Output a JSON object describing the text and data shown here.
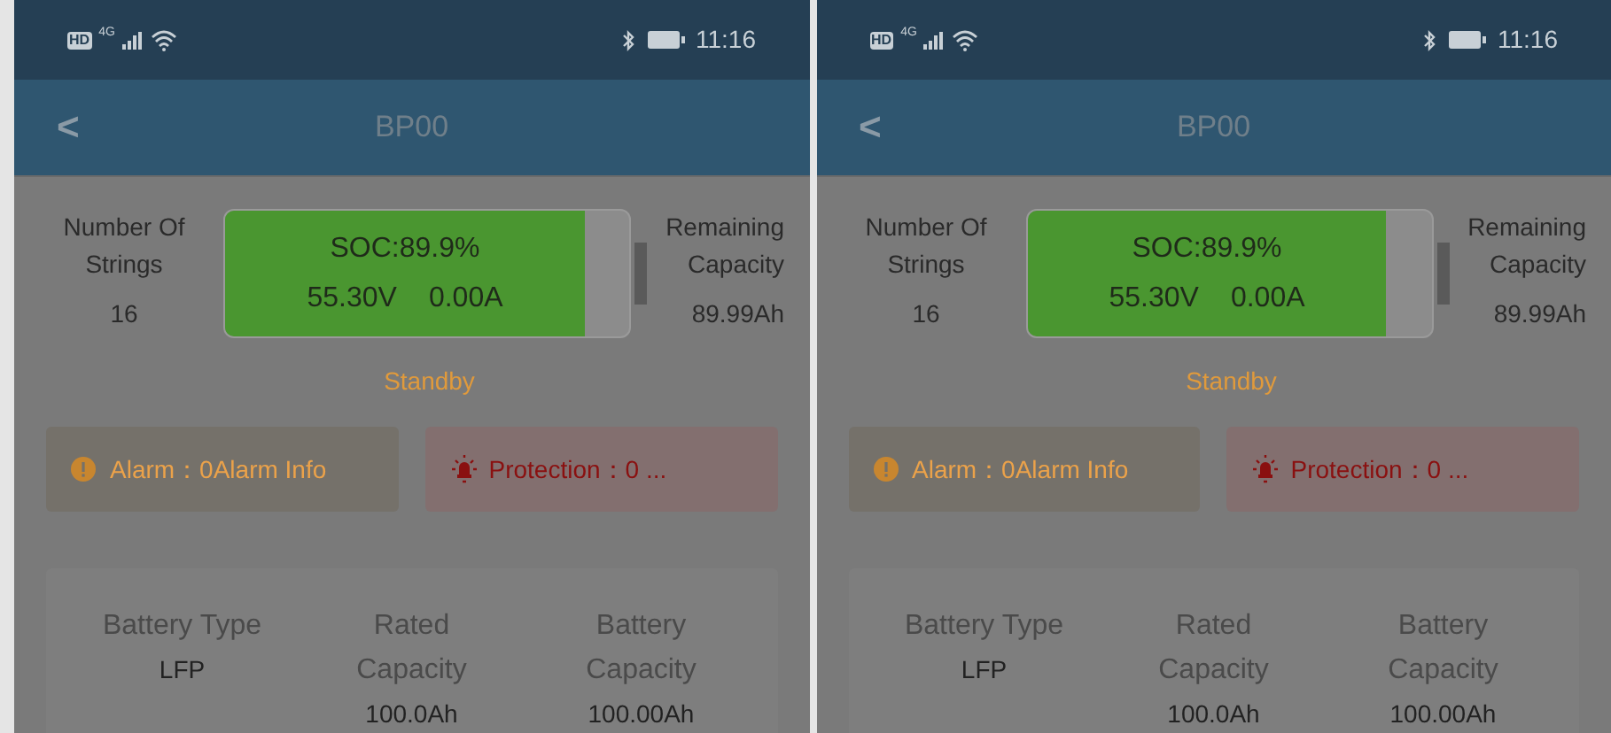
{
  "screens": [
    {
      "status_bar": {
        "hd": "HD",
        "network": "4G",
        "time": "11:16"
      },
      "header": {
        "back": "<",
        "title": "BP00"
      },
      "strings": {
        "label": "Number Of Strings",
        "value": "16"
      },
      "battery": {
        "soc": "SOC:89.9%",
        "voltage": "55.30V",
        "current": "0.00A",
        "level": 0.89
      },
      "remaining": {
        "label": "Remaining Capacity",
        "value": "89.99Ah"
      },
      "state": "Standby",
      "alarm": "Alarm：0Alarm Info",
      "protection": "Protection：0 ...",
      "info": [
        {
          "label": "Battery Type",
          "value": "LFP"
        },
        {
          "label": "Rated Capacity",
          "value": "100.0Ah"
        },
        {
          "label": "Battery Capacity",
          "value": "100.00Ah"
        }
      ]
    },
    {
      "status_bar": {
        "hd": "HD",
        "network": "4G",
        "time": "11:16"
      },
      "header": {
        "back": "<",
        "title": "BP00"
      },
      "strings": {
        "label": "Number Of Strings",
        "value": "16"
      },
      "battery": {
        "soc": "SOC:89.9%",
        "voltage": "55.30V",
        "current": "0.00A",
        "level": 0.89
      },
      "remaining": {
        "label": "Remaining Capacity",
        "value": "89.99Ah"
      },
      "state": "Standby",
      "alarm": "Alarm：0Alarm Info",
      "protection": "Protection：0 ...",
      "info": [
        {
          "label": "Battery Type",
          "value": "LFP"
        },
        {
          "label": "Rated Capacity",
          "value": "100.0Ah"
        },
        {
          "label": "Battery Capacity",
          "value": "100.00Ah"
        }
      ]
    }
  ]
}
